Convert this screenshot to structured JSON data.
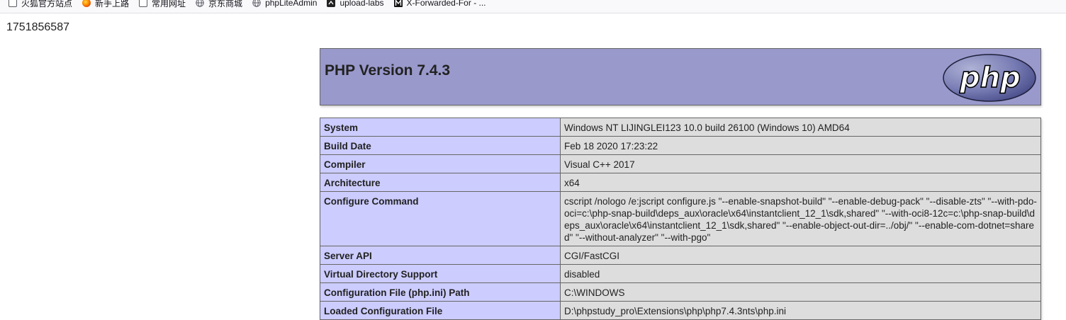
{
  "bookmarks": [
    {
      "label": "火狐官方站点",
      "icon": "folder-icon"
    },
    {
      "label": "新手上路",
      "icon": "firefox-icon"
    },
    {
      "label": "常用网址",
      "icon": "folder-icon"
    },
    {
      "label": "京东商城",
      "icon": "globe-icon"
    },
    {
      "label": "phpLiteAdmin",
      "icon": "globe-icon"
    },
    {
      "label": "upload-labs",
      "icon": "upload-labs-icon"
    },
    {
      "label": "X-Forwarded-For - ...",
      "icon": "m-logo-icon"
    }
  ],
  "timestamp": "1751856587",
  "php": {
    "version_title": "PHP Version 7.4.3",
    "logo_text": "php"
  },
  "info_rows": [
    {
      "key": "System",
      "value": "Windows NT LIJINGLEI123 10.0 build 26100 (Windows 10) AMD64"
    },
    {
      "key": "Build Date",
      "value": "Feb 18 2020 17:23:22"
    },
    {
      "key": "Compiler",
      "value": "Visual C++ 2017"
    },
    {
      "key": "Architecture",
      "value": "x64"
    },
    {
      "key": "Configure Command",
      "value": "cscript /nologo /e:jscript configure.js \"--enable-snapshot-build\" \"--enable-debug-pack\" \"--disable-zts\" \"--with-pdo-oci=c:\\php-snap-build\\deps_aux\\oracle\\x64\\instantclient_12_1\\sdk,shared\" \"--with-oci8-12c=c:\\php-snap-build\\deps_aux\\oracle\\x64\\instantclient_12_1\\sdk,shared\" \"--enable-object-out-dir=../obj/\" \"--enable-com-dotnet=shared\" \"--without-analyzer\" \"--with-pgo\""
    },
    {
      "key": "Server API",
      "value": "CGI/FastCGI"
    },
    {
      "key": "Virtual Directory Support",
      "value": "disabled"
    },
    {
      "key": "Configuration File (php.ini) Path",
      "value": "C:\\WINDOWS"
    },
    {
      "key": "Loaded Configuration File",
      "value": "D:\\phpstudy_pro\\Extensions\\php\\php7.4.3nts\\php.ini"
    }
  ],
  "colors": {
    "header_bg": "#9999cc",
    "key_bg": "#ccccff",
    "value_bg": "#dddddd",
    "border": "#666666"
  }
}
